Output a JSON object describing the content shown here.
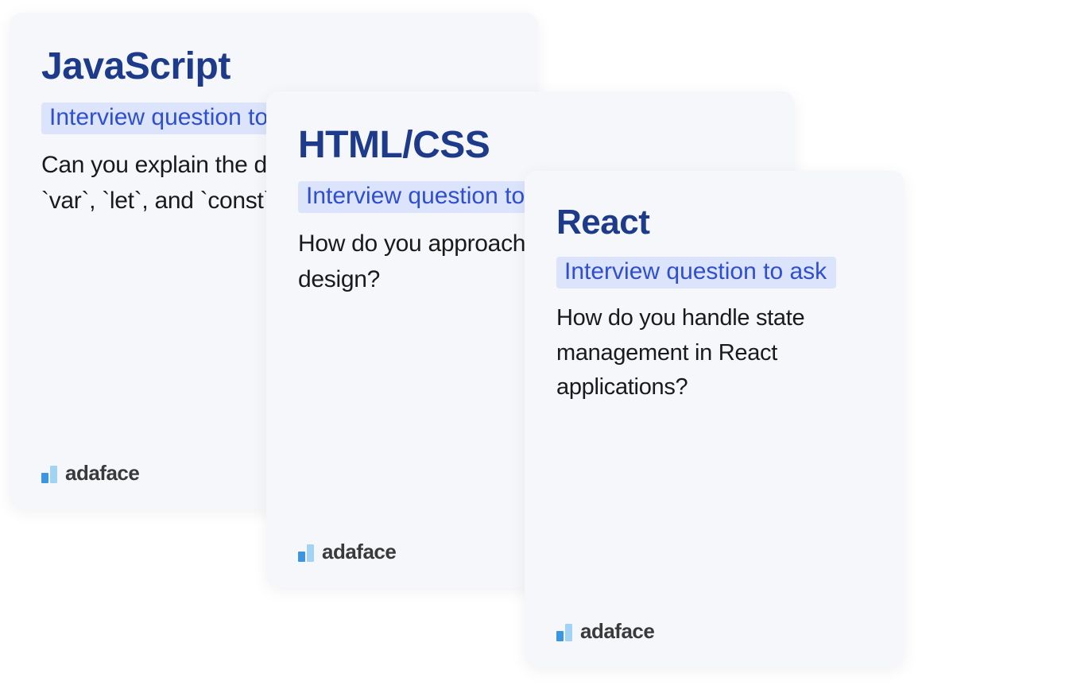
{
  "cards": [
    {
      "title": "JavaScript",
      "label": "Interview question to ask",
      "question": "Can you explain the difference between `var`, `let`, and `const` in JavaScript?"
    },
    {
      "title": "HTML/CSS",
      "label": "Interview question to ask",
      "question": "How do you approach responsive web design?"
    },
    {
      "title": "React",
      "label": "Interview question to ask",
      "question": "How do you handle state management in React applications?"
    }
  ],
  "brand": "adaface"
}
